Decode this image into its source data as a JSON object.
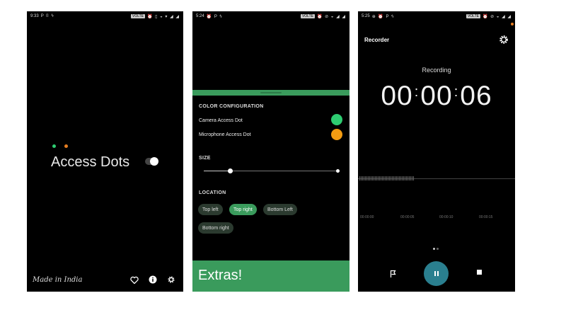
{
  "phone1": {
    "status_bar": {
      "time": "9:33",
      "left_icons": "P ⌷ ϟ",
      "tag": "VOLTE",
      "right_icons": "⏰ ▯ ◒ ▾ ◢ ◢"
    },
    "app_title": "Access Dots",
    "footer_text": "Made in India",
    "toggle_on": true
  },
  "phone2": {
    "status_bar": {
      "time": "5:24",
      "left_icons": "⏰ P ϟ",
      "tag": "VOLTE",
      "right_icons": "⏰ ⊘ ◒ ◢ ◢"
    },
    "sections": {
      "color": "COLOR CONFIGURATION",
      "size": "SIZE",
      "location": "LOCATION"
    },
    "color_rows": [
      {
        "label": "Camera Access Dot",
        "color": "#2ecc71"
      },
      {
        "label": "Microphone Access Dot",
        "color": "#f39c12"
      }
    ],
    "size_value": 0.2,
    "location_chips": [
      {
        "label": "Top left",
        "active": false
      },
      {
        "label": "Top right",
        "active": true
      },
      {
        "label": "Bottom Left",
        "active": false
      },
      {
        "label": "Bottom right",
        "active": false
      }
    ],
    "extras_label": "Extras!"
  },
  "phone3": {
    "status_bar": {
      "time": "5:25",
      "left_icons": "⊕ ⏰ P ϟ",
      "tag": "VOLTE",
      "right_icons": "⏰ ⊘ ◒ ◢ ◢"
    },
    "app_title": "Recorder",
    "recording_label": "Recording",
    "timer": {
      "hours": "00",
      "minutes": "00",
      "seconds": "06"
    },
    "timeline_ticks": [
      "00:00:00",
      "00:00:05",
      "00:00:10",
      "00:00:15"
    ],
    "colors": {
      "accent": "#2a7f8f",
      "brand_green": "#3a9b5c"
    }
  }
}
